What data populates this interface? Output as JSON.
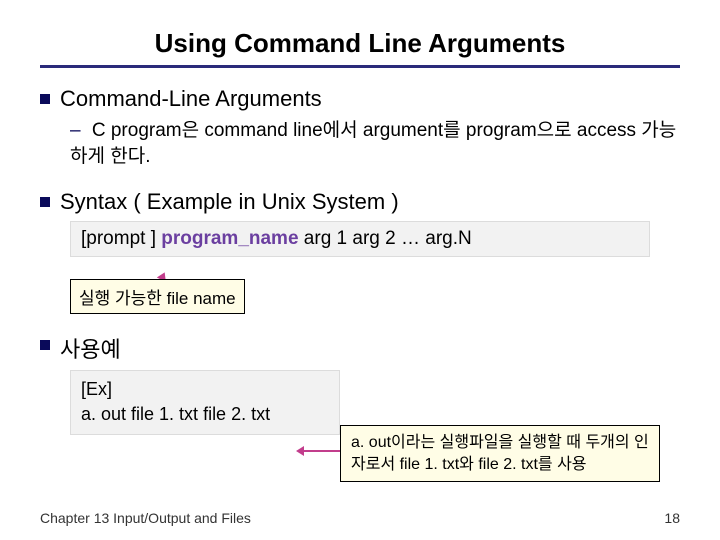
{
  "title": "Using Command Line Arguments",
  "s1": {
    "heading": "Command-Line Arguments",
    "line": "C program은 command line에서 argument를 program으로 access 가능하게 한다."
  },
  "s2": {
    "heading": "Syntax ( Example in Unix System )",
    "prompt": "[prompt ] ",
    "prog": "program_name",
    "args": "  arg 1 arg 2   … arg.N",
    "label": "실행 가능한 file name"
  },
  "s3": {
    "heading": "사용예",
    "ex_label": "[Ex]",
    "ex_cmd": "a. out file 1. txt file 2. txt",
    "desc": "a. out이라는 실행파일을 실행할 때 두개의 인자로서 file 1. txt와 file 2. txt를 사용"
  },
  "footer": "Chapter 13   Input/Output and Files",
  "page": "18"
}
